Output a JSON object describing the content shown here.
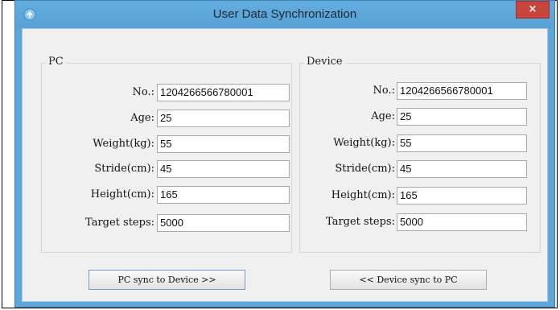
{
  "window": {
    "title": "User Data Synchronization",
    "close_glyph": "×"
  },
  "pc_group": {
    "legend": "PC",
    "fields": [
      {
        "label": "No.:",
        "value": "1204266566780001"
      },
      {
        "label": "Age:",
        "value": "25"
      },
      {
        "label": "Weight(kg):",
        "value": "55"
      },
      {
        "label": "Stride(cm):",
        "value": "45"
      },
      {
        "label": "Height(cm):",
        "value": "165"
      },
      {
        "label": "Target steps:",
        "value": "5000"
      }
    ]
  },
  "device_group": {
    "legend": "Device",
    "fields": [
      {
        "label": "No.:",
        "value": "1204266566780001"
      },
      {
        "label": "Age:",
        "value": "25"
      },
      {
        "label": "Weight(kg):",
        "value": "55"
      },
      {
        "label": "Stride(cm):",
        "value": "45"
      },
      {
        "label": "Height(cm):",
        "value": "165"
      },
      {
        "label": "Target steps:",
        "value": "5000"
      }
    ]
  },
  "buttons": {
    "pc_to_device": "PC sync to Device >>",
    "device_to_pc": "<< Device sync to PC"
  },
  "colors": {
    "titlebar": "#5ca6d9",
    "close_button": "#c7453a",
    "client_background": "#f0f0f0"
  }
}
